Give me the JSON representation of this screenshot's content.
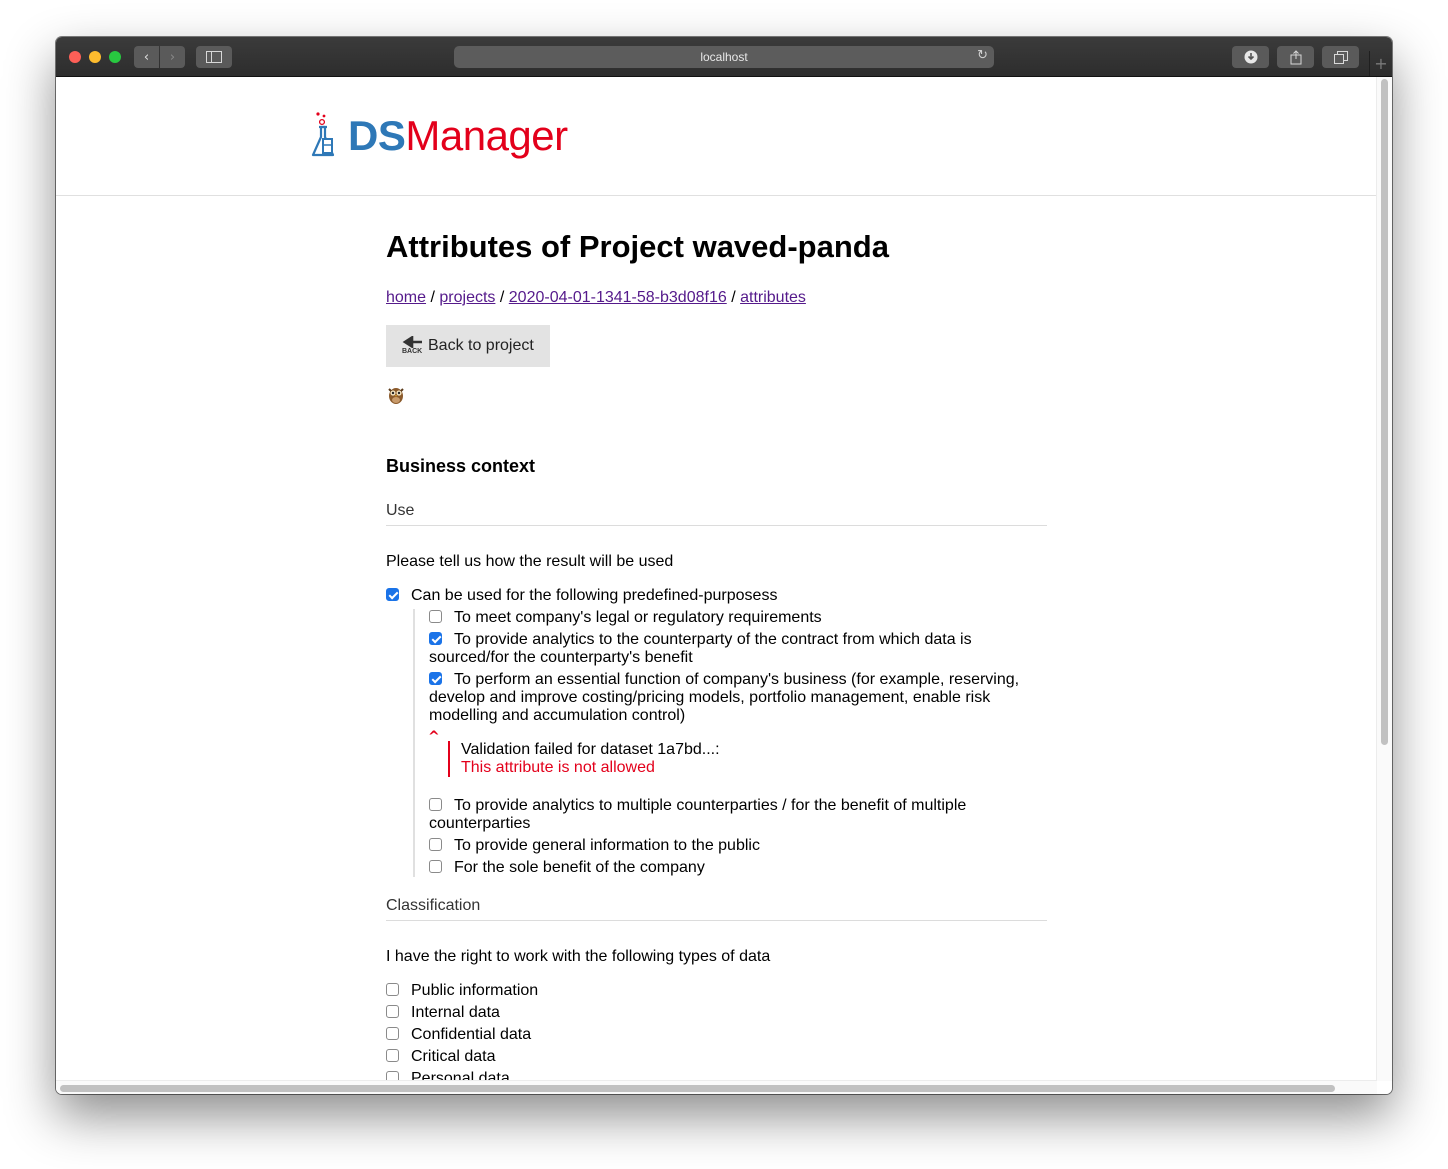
{
  "browser": {
    "url": "localhost"
  },
  "logo": {
    "part1": "DS",
    "part2": "Manager"
  },
  "page": {
    "title": "Attributes of Project waved-panda",
    "breadcrumbs": {
      "home": "home",
      "projects": "projects",
      "project_id": "2020-04-01-1341-58-b3d08f16",
      "attributes": "attributes",
      "separator": "/"
    },
    "back_button": "Back to project",
    "back_icon_text": "BACK"
  },
  "business_context": {
    "heading": "Business context",
    "use": {
      "label": "Use",
      "prompt": "Please tell us how the result will be used",
      "main_option": {
        "label": "Can be used for the following predefined-purposess",
        "checked": true
      },
      "sub_options": [
        {
          "label": "To meet company's legal or regulatory requirements",
          "checked": false
        },
        {
          "label": "To provide analytics to the counterparty of the contract from which data is sourced/for the counterparty's benefit",
          "checked": true
        },
        {
          "label": "To perform an essential function of company's business (for example, reserving, develop and improve costing/pricing models, portfolio management, enable risk modelling and accumulation control)",
          "checked": true
        },
        {
          "label": "To provide analytics to multiple counterparties / for the benefit of multiple counterparties",
          "checked": false
        },
        {
          "label": "To provide general information to the public",
          "checked": false
        },
        {
          "label": "For the sole benefit of the company",
          "checked": false
        }
      ],
      "validation": {
        "message": "Validation failed for dataset 1a7bd...:",
        "error": "This attribute is not allowed"
      }
    },
    "classification": {
      "label": "Classification",
      "prompt": "I have the right to work with the following types of data",
      "options": [
        {
          "label": "Public information",
          "checked": false
        },
        {
          "label": "Internal data",
          "checked": false
        },
        {
          "label": "Confidential data",
          "checked": false
        },
        {
          "label": "Critical data",
          "checked": false
        },
        {
          "label": "Personal data",
          "checked": false
        }
      ]
    }
  },
  "colors": {
    "accent_blue": "#2e78b7",
    "accent_red": "#e3001b",
    "checkbox_blue": "#1a73e8",
    "link": "#551a8b"
  }
}
